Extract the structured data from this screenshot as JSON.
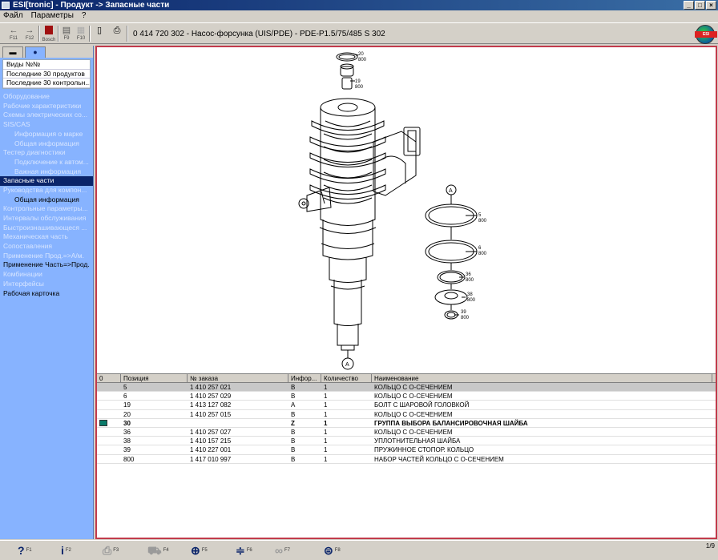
{
  "window": {
    "title": "ESI[tronic] - Продукт -> Запасные части"
  },
  "menu": [
    "Файл",
    "Параметры",
    "?"
  ],
  "toolbar": {
    "back_key": "F11",
    "forward_key": "F12",
    "bosch_key": "Bosch",
    "f9_key": "F9",
    "f10_key": "F10",
    "product_title": "0 414 720 302 - Насос-форсунка (UIS/PDE) - PDE-P1.5/75/485 S 302"
  },
  "sidebar": {
    "top_items": [
      "Виды №№",
      "Последние 30 продуктов",
      "Последние 30 контрольн..."
    ],
    "nav": [
      {
        "label": "Оборудование",
        "state": "disabled",
        "level": 0
      },
      {
        "label": "Рабочие характеристики",
        "state": "disabled",
        "level": 0
      },
      {
        "label": "Схемы электрических со...",
        "state": "disabled",
        "level": 0
      },
      {
        "label": "SIS/CAS",
        "state": "disabled",
        "level": 0
      },
      {
        "label": "Информация о марке",
        "state": "disabled",
        "level": 1
      },
      {
        "label": "Общая информация",
        "state": "disabled",
        "level": 1
      },
      {
        "label": "Тестер диагностики",
        "state": "disabled",
        "level": 0
      },
      {
        "label": "Подключение к автом...",
        "state": "disabled",
        "level": 1
      },
      {
        "label": "Важная информация",
        "state": "disabled",
        "level": 1
      },
      {
        "label": "Запасные части",
        "state": "selected",
        "level": 0
      },
      {
        "label": "Руководства для компон...",
        "state": "disabled",
        "level": 0
      },
      {
        "label": "Общая информация",
        "state": "normal",
        "level": 1
      },
      {
        "label": "Контрольные параметры...",
        "state": "disabled",
        "level": 0
      },
      {
        "label": "Интервалы обслуживания",
        "state": "disabled",
        "level": 0
      },
      {
        "label": "Быстроизнашивающеся ...",
        "state": "disabled",
        "level": 0
      },
      {
        "label": "Механическая часть",
        "state": "disabled",
        "level": 0
      },
      {
        "label": "Сопоставления",
        "state": "disabled",
        "level": 0
      },
      {
        "label": "Применение Прод.=>А/м.",
        "state": "disabled",
        "level": 0
      },
      {
        "label": "Применение Часть=>Прод.",
        "state": "normal",
        "level": 0
      },
      {
        "label": "Комбинации",
        "state": "disabled",
        "level": 0
      },
      {
        "label": "Интерфейсы",
        "state": "disabled",
        "level": 0
      },
      {
        "label": "Рабочая карточка",
        "state": "normal",
        "level": 0
      }
    ]
  },
  "drawing": {
    "callouts": {
      "c20": "20",
      "c800a": "800",
      "c19": "19",
      "c800b": "800",
      "A1": "A",
      "A2": "A",
      "c5": "5",
      "c800c": "800",
      "c6": "6",
      "c800d": "800",
      "c36": "36",
      "c800e": "800",
      "c38": "38",
      "c800f": "800",
      "c39": "39",
      "c800g": "800"
    }
  },
  "table": {
    "headers": [
      "0",
      "Позиция",
      "№ заказа",
      "Инфор...",
      "Количество",
      "Наименование"
    ],
    "rows": [
      {
        "pos": "5",
        "order": "1 410 257 021",
        "info": "B",
        "qty": "1",
        "name": "КОЛЬЦО С О-СЕЧЕНИЕМ",
        "selected": true,
        "bold": false,
        "marker": false
      },
      {
        "pos": "6",
        "order": "1 410 257 029",
        "info": "B",
        "qty": "1",
        "name": "КОЛЬЦО С О-СЕЧЕНИЕМ",
        "selected": false,
        "bold": false,
        "marker": false
      },
      {
        "pos": "19",
        "order": "1 413 127 082",
        "info": "A",
        "qty": "1",
        "name": "БОЛТ С ШАРОВОЙ ГОЛОВКОЙ",
        "selected": false,
        "bold": false,
        "marker": false
      },
      {
        "pos": "20",
        "order": "1 410 257 015",
        "info": "B",
        "qty": "1",
        "name": "КОЛЬЦО С О-СЕЧЕНИЕМ",
        "selected": false,
        "bold": false,
        "marker": false
      },
      {
        "pos": "30",
        "order": "",
        "info": "Z",
        "qty": "1",
        "name": "ГРУППА ВЫБОРА БАЛАНСИРОВОЧНАЯ ШАЙБА",
        "selected": false,
        "bold": true,
        "marker": true
      },
      {
        "pos": "36",
        "order": "1 410 257 027",
        "info": "B",
        "qty": "1",
        "name": "КОЛЬЦО С О-СЕЧЕНИЕМ",
        "selected": false,
        "bold": false,
        "marker": false
      },
      {
        "pos": "38",
        "order": "1 410 157 215",
        "info": "B",
        "qty": "1",
        "name": "УПЛОТНИТЕЛЬНАЯ ШАЙБА",
        "selected": false,
        "bold": false,
        "marker": false
      },
      {
        "pos": "39",
        "order": "1 410 227 001",
        "info": "B",
        "qty": "1",
        "name": "ПРУЖИННОЕ СТОПОР. КОЛЬЦО",
        "selected": false,
        "bold": false,
        "marker": false
      },
      {
        "pos": "800",
        "order": "1 417 010 997",
        "info": "B",
        "qty": "1",
        "name": "НАБОР ЧАСТЕЙ КОЛЬЦО С О-СЕЧЕНИЕМ",
        "selected": false,
        "bold": false,
        "marker": false
      }
    ]
  },
  "bottombar": {
    "help_key": "F1",
    "info_key": "F2",
    "print_key": "F3",
    "f4_key": "F4",
    "zoom_key": "F5",
    "split_key": "F6",
    "glasses_key": "F7",
    "f8_key": "F8",
    "page": "1/9"
  }
}
